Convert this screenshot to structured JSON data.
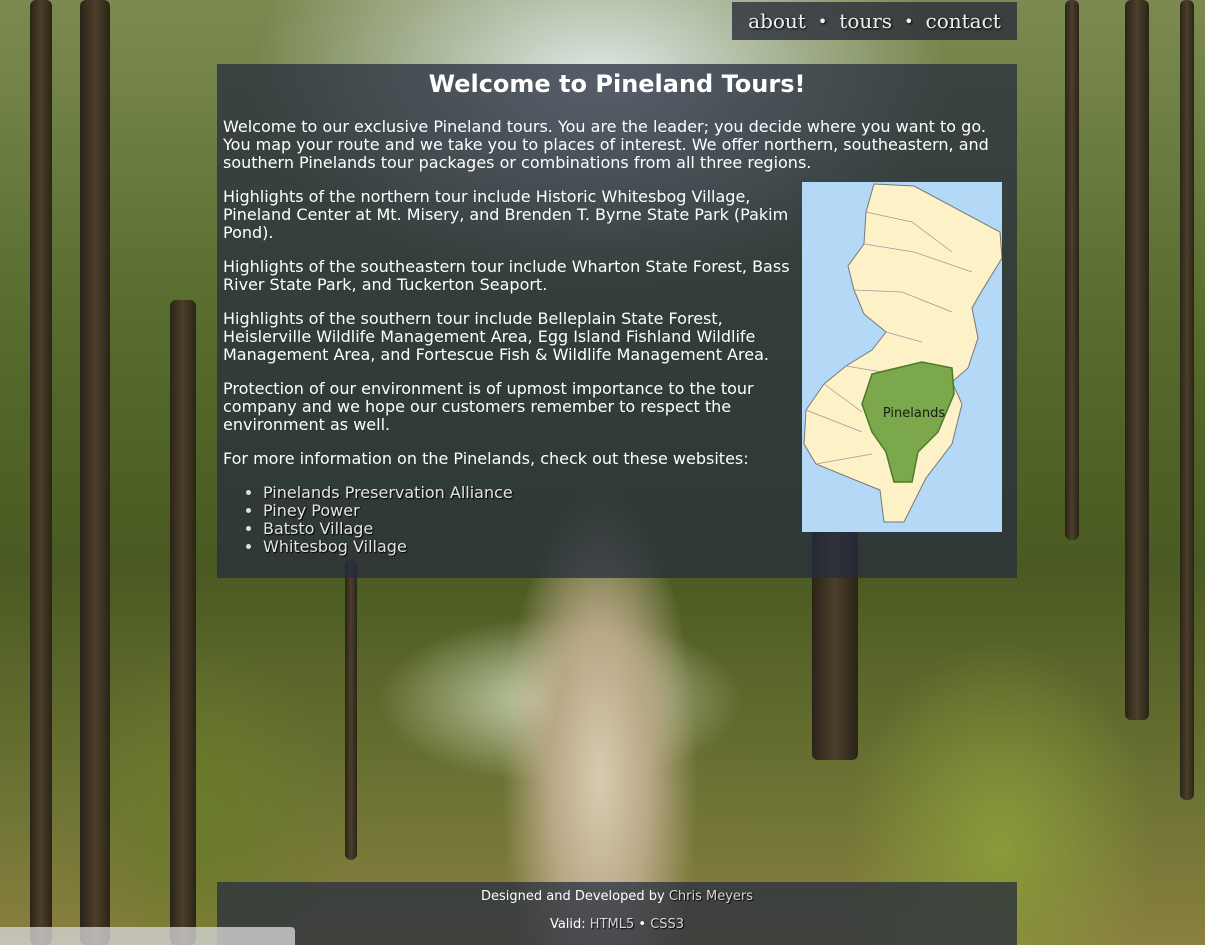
{
  "nav": {
    "items": [
      "about",
      "tours",
      "contact"
    ],
    "separator": "•"
  },
  "main": {
    "title": "Welcome to Pineland Tours!",
    "intro": "Welcome to our exclusive Pineland tours. You are the leader; you decide where you want to go. You map your route and we take you to places of interest. We offer northern, southeastern, and southern Pinelands tour packages or combinations from all three regions.",
    "paragraphs": [
      "Highlights of the northern tour include Historic Whitesbog Village, Pineland Center at Mt. Misery, and Brenden T. Byrne State Park (Pakim Pond).",
      "Highlights of the southeastern tour include Wharton State Forest, Bass River State Park, and Tuckerton Seaport.",
      "Highlights of the southern tour include Belleplain State Forest, Heislerville Wildlife Management Area, Egg Island Fishland Wildlife Management Area, and Fortescue Fish & Wildlife Management Area.",
      "Protection of our environment is of upmost importance to the tour company and we hope our customers remember to respect the environment as well.",
      "For more information on the Pinelands, check out these websites:"
    ],
    "links": [
      "Pinelands Preservation Alliance",
      "Piney Power",
      "Batsto Village",
      "Whitesbog Village"
    ],
    "map_label": "Pinelands"
  },
  "footer": {
    "designed_prefix": "Designed and Developed by",
    "author": "Chris Meyers",
    "valid_prefix": "Valid:",
    "html5": "HTML5",
    "separator": "•",
    "css3": "CSS3"
  },
  "colors": {
    "panel_bg": "#262c3e",
    "map_water": "#b3d9f7",
    "map_land": "#fdf1c8",
    "map_pinelands": "#7aa84a"
  }
}
